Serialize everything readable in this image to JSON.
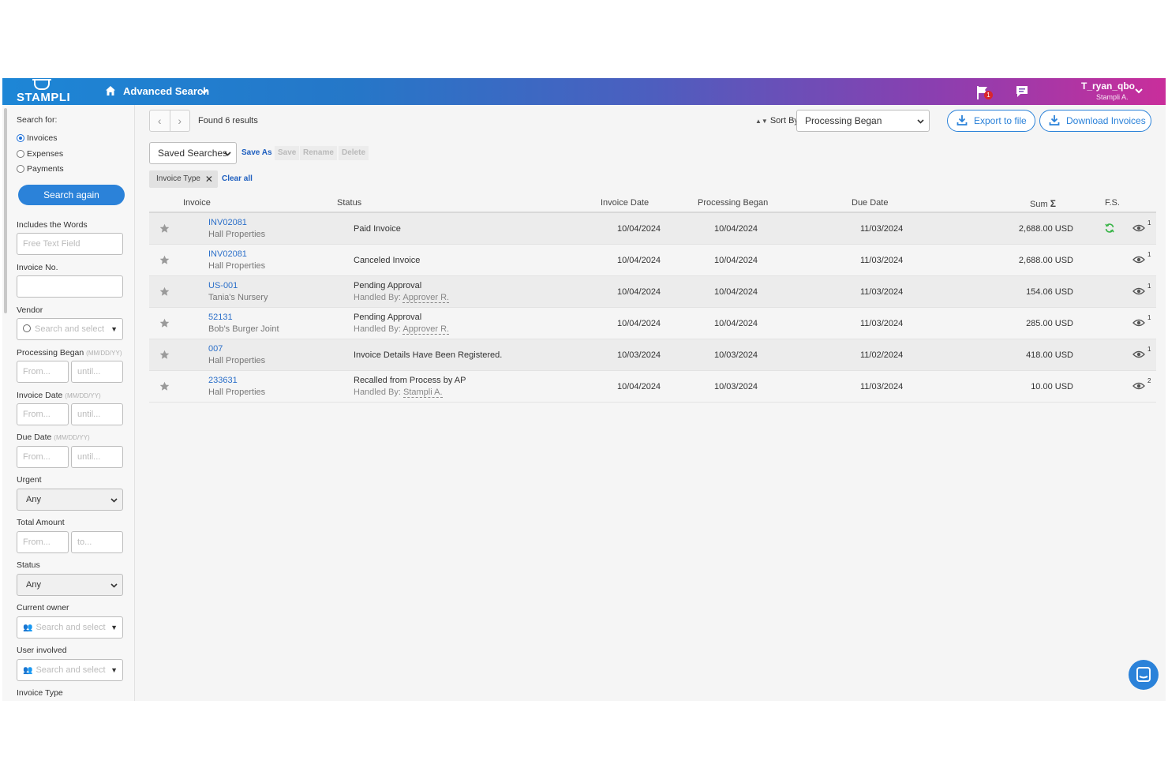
{
  "topbar": {
    "logo_text": "STAMPLI",
    "nav_title": "Advanced Search",
    "flag_badge": "1",
    "user_name": "T_ryan_qbo",
    "user_sub": "Stampli A."
  },
  "sidebar": {
    "search_for_label": "Search for:",
    "radios": [
      {
        "label": "Invoices",
        "checked": true
      },
      {
        "label": "Expenses",
        "checked": false
      },
      {
        "label": "Payments",
        "checked": false
      }
    ],
    "search_again": "Search again",
    "includes_words_label": "Includes the Words",
    "includes_words_placeholder": "Free Text Field",
    "invoice_no_label": "Invoice No.",
    "vendor_label": "Vendor",
    "vendor_placeholder": "Search and select",
    "processing_began_label": "Processing Began",
    "invoice_date_label": "Invoice Date",
    "due_date_label": "Due Date",
    "date_hint": "(MM/DD/YY)",
    "from_placeholder": "From...",
    "until_placeholder": "until...",
    "to_placeholder": "to...",
    "urgent_label": "Urgent",
    "urgent_value": "Any",
    "total_amount_label": "Total Amount",
    "status_label": "Status",
    "status_value": "Any",
    "current_owner_label": "Current owner",
    "current_owner_placeholder": "Search and select",
    "user_involved_label": "User involved",
    "user_involved_placeholder": "Search and select",
    "invoice_type_label": "Invoice Type"
  },
  "toolbar": {
    "found": "Found 6 results",
    "sort_by_label": "Sort By",
    "sort_value": "Processing Began",
    "export_label": "Export to file",
    "download_label": "Download Invoices",
    "saved_searches": "Saved Searches",
    "save_as": "Save As",
    "save": "Save",
    "rename": "Rename",
    "delete": "Delete",
    "filter_chip": "Invoice Type",
    "clear_all": "Clear all"
  },
  "table": {
    "headers": {
      "invoice": "Invoice",
      "status": "Status",
      "invoice_date": "Invoice Date",
      "processing_began": "Processing Began",
      "due_date": "Due Date",
      "sum": "Sum",
      "sum_symbol": "Σ",
      "fs": "F.S."
    },
    "rows": [
      {
        "invoice": "INV02081",
        "vendor": "Hall Properties",
        "status": "Paid Invoice",
        "handled_prefix": "",
        "handled_by": "",
        "invoice_date": "10/04/2024",
        "processing_began": "10/04/2024",
        "due_date": "11/03/2024",
        "sum": "2,688.00 USD",
        "views": "1",
        "fs_synced": true
      },
      {
        "invoice": "INV02081",
        "vendor": "Hall Properties",
        "status": "Canceled Invoice",
        "handled_prefix": "",
        "handled_by": "",
        "invoice_date": "10/04/2024",
        "processing_began": "10/04/2024",
        "due_date": "11/03/2024",
        "sum": "2,688.00 USD",
        "views": "1",
        "fs_synced": false
      },
      {
        "invoice": "US-001",
        "vendor": "Tania's Nursery",
        "status": "Pending Approval",
        "handled_prefix": "Handled By:",
        "handled_by": "Approver R.",
        "invoice_date": "10/04/2024",
        "processing_began": "10/04/2024",
        "due_date": "11/03/2024",
        "sum": "154.06 USD",
        "views": "1",
        "fs_synced": false
      },
      {
        "invoice": "52131",
        "vendor": "Bob's Burger Joint",
        "status": "Pending Approval",
        "handled_prefix": "Handled By:",
        "handled_by": "Approver R.",
        "invoice_date": "10/04/2024",
        "processing_began": "10/04/2024",
        "due_date": "11/03/2024",
        "sum": "285.00 USD",
        "views": "1",
        "fs_synced": false
      },
      {
        "invoice": "007",
        "vendor": "Hall Properties",
        "status": "Invoice Details Have Been Registered.",
        "handled_prefix": "",
        "handled_by": "",
        "invoice_date": "10/03/2024",
        "processing_began": "10/03/2024",
        "due_date": "11/02/2024",
        "sum": "418.00 USD",
        "views": "1",
        "fs_synced": false
      },
      {
        "invoice": "233631",
        "vendor": "Hall Properties",
        "status": "Recalled from Process by AP",
        "handled_prefix": "Handled By:",
        "handled_by": "Stampli A.",
        "invoice_date": "10/04/2024",
        "processing_began": "10/03/2024",
        "due_date": "11/03/2024",
        "sum": "10.00 USD",
        "views": "2",
        "fs_synced": false
      }
    ]
  },
  "colors": {
    "accent": "#2b82d9",
    "link": "#2b6fc9",
    "sync_green": "#3bb54a"
  }
}
